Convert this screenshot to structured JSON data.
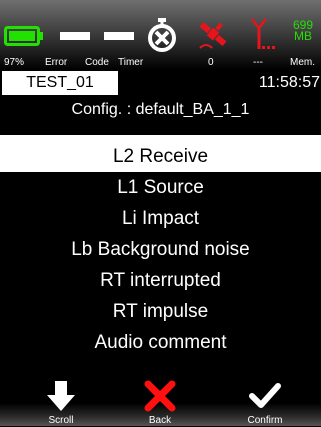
{
  "status_bar": {
    "battery_percent": "97%",
    "battery_level": 0.97,
    "error_label": "Error",
    "code_label": "Code",
    "timer_label": "Timer",
    "sat_value": "0",
    "antenna_value": "---",
    "mem_value": "699",
    "mem_unit": "MB",
    "mem_label": "Mem.",
    "icons": [
      "battery-icon",
      "error-indicator-icon",
      "code-indicator-icon",
      "timer-icon",
      "satellite-icon",
      "antenna-icon"
    ],
    "colors": {
      "battery": "#22e000",
      "satellite": "#e8141c",
      "antenna": "#e8141c",
      "memory": "#22e000"
    }
  },
  "header": {
    "test_name": "TEST_01",
    "time": "11:58:57",
    "config": "Config. : default_BA_1_1"
  },
  "menu": {
    "items": [
      {
        "label": "L2 Receive",
        "selected": true
      },
      {
        "label": "L1 Source",
        "selected": false
      },
      {
        "label": "Li Impact",
        "selected": false
      },
      {
        "label": "Lb Background noise",
        "selected": false
      },
      {
        "label": "RT interrupted",
        "selected": false
      },
      {
        "label": "RT impulse",
        "selected": false
      },
      {
        "label": "Audio comment",
        "selected": false
      }
    ]
  },
  "softkeys": {
    "scroll": {
      "label": "Scroll",
      "icon": "arrow-down-icon"
    },
    "back": {
      "label": "Back",
      "icon": "close-icon",
      "color": "#ff1010"
    },
    "confirm": {
      "label": "Confirm",
      "icon": "checkmark-icon"
    }
  }
}
